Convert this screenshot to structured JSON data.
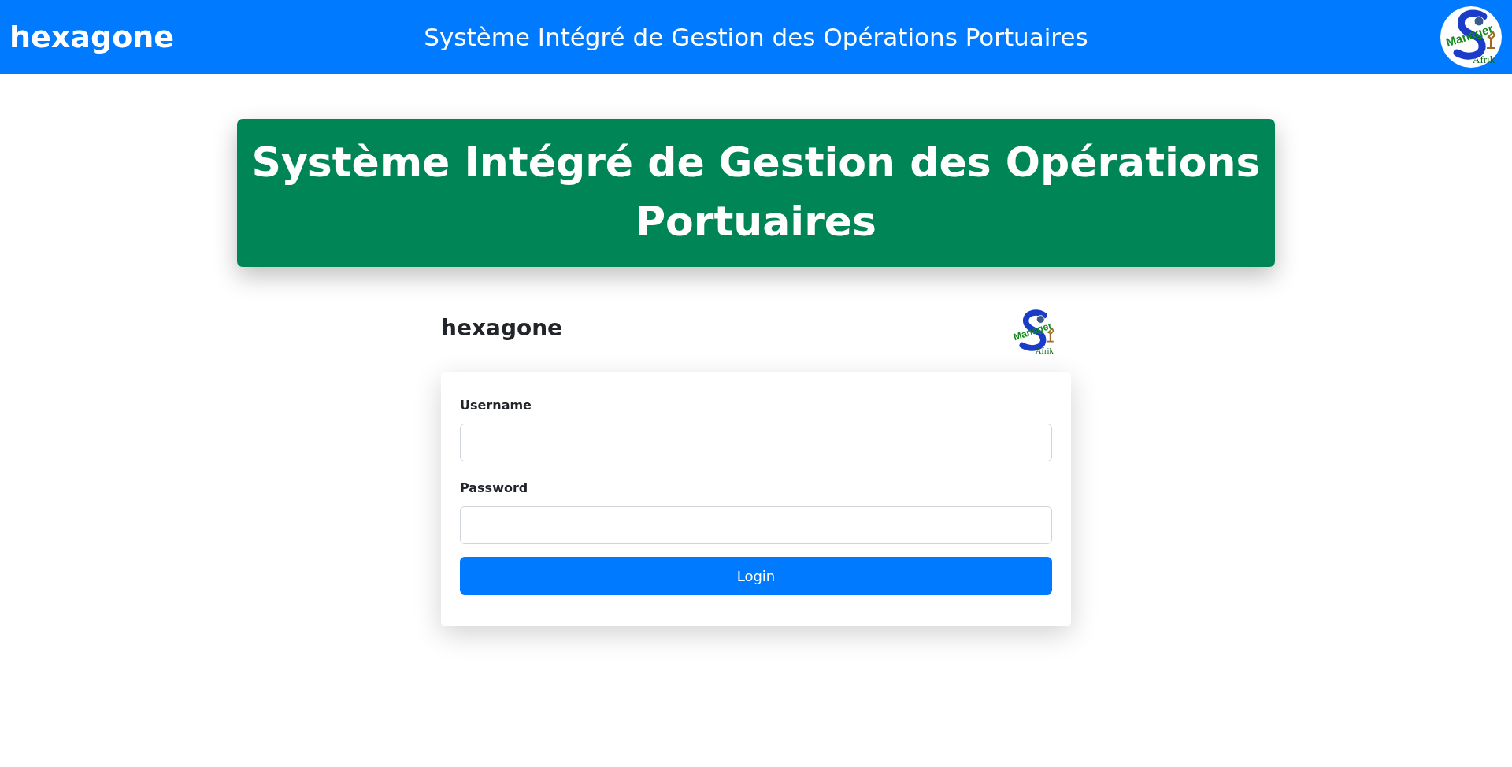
{
  "navbar": {
    "brand": "hexagone",
    "title": "Système Intégré de Gestion des Opérations Portuaires",
    "logo": {
      "word_1": "Manager",
      "word_2": "Afrik"
    }
  },
  "banner": {
    "title": "Système Intégré de Gestion des Opérations Portuaires"
  },
  "login": {
    "brand": "hexagone",
    "logo": {
      "word_1": "Manager",
      "word_2": "Afrik"
    },
    "fields": [
      {
        "label": "Username"
      },
      {
        "label": "Password"
      }
    ],
    "button": "Login"
  }
}
